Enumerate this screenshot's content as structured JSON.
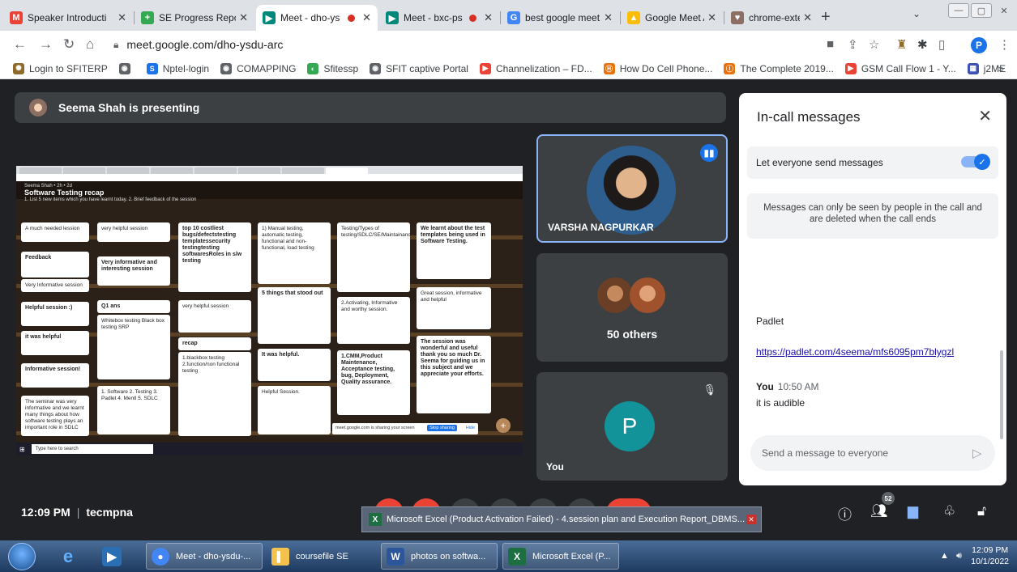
{
  "browser": {
    "tabs": [
      {
        "title": "Speaker Introducti",
        "fav_color": "#ea4335",
        "fav_glyph": "M"
      },
      {
        "title": "SE Progress Repor",
        "fav_color": "#34a853",
        "fav_glyph": "+"
      },
      {
        "title": "Meet - dho-ys",
        "fav_color": "#00897b",
        "fav_glyph": "▶",
        "recording": true,
        "active": true
      },
      {
        "title": "Meet - bxc-ps",
        "fav_color": "#00897b",
        "fav_glyph": "▶",
        "recording": true
      },
      {
        "title": "best google meet",
        "fav_color": "#4285f4",
        "fav_glyph": "G"
      },
      {
        "title": "Google Meet Atte",
        "fav_color": "#fbbc04",
        "fav_glyph": "▲"
      },
      {
        "title": "chrome-extension",
        "fav_color": "#8d6e63",
        "fav_glyph": "♥"
      }
    ],
    "url": "meet.google.com/dho-ysdu-arc",
    "profile_initial": "P",
    "bookmarks": [
      {
        "label": "Login to SFITERP",
        "color": "#8e6b2b"
      },
      {
        "label": "",
        "color": "#5f6368"
      },
      {
        "label": "Nptel-login",
        "color": "#1a73e8"
      },
      {
        "label": "COMAPPING",
        "color": "#5f6368"
      },
      {
        "label": "Sfitessp",
        "color": "#34a853"
      },
      {
        "label": "SFIT captive Portal",
        "color": "#5f6368"
      },
      {
        "label": "Channelization – FD...",
        "color": "#ea4335"
      },
      {
        "label": "How Do Cell Phone...",
        "color": "#e8710a"
      },
      {
        "label": "The Complete 2019...",
        "color": "#e8710a"
      },
      {
        "label": "GSM Call Flow 1 - Y...",
        "color": "#ea4335"
      },
      {
        "label": "j2ME",
        "color": "#3f51b5"
      }
    ]
  },
  "meet": {
    "presenter_banner": "Seema Shah is presenting",
    "shared_screen": {
      "board_author": "Seema Shah • 2h • 2d",
      "board_title": "Software Testing recap",
      "board_subtitle": "1. List 5 new items which you have learnt today. 2. Brief feedback of the session",
      "cards": [
        "A much needed lession",
        "Feedback",
        "Very Informative session",
        "Helpful session :)",
        "it was helpful",
        "Informative session!",
        "The seminar was very informative and we learnt many things about how software testing plays an important role in SDLC",
        "very helpful session",
        "Very informative and interesting session",
        "Q1 ans",
        "Whitebox testing Black box testing SRP",
        "1. Software 2. Testing 3. Padlet 4. Mentl 5. SDLC",
        "top 10 costliest bugs/defectstesting templatessecurity testingtesting softwaresRoles in s/w testing",
        "very helpful session",
        "recap",
        "1.blackbox testing 2.function/non functional testing",
        "1) Manual testing, automatic testing, functional and non-functional, load testing",
        "5 things that stood out",
        "It was helpful.",
        "Helpful Session.",
        "Testing/Types of testing/SDLC/SE/Maintainance",
        "2.Activating, Informative and worthy session.",
        "1.CMM,Product Maintenance, Acceptance testing, bug, Deployment, Quality assurance.",
        "We learnt about the test templates being used in Software Testing.",
        "Great session, informative and helpful",
        "The session was wonderful and useful thank you so much Dr. Seema for guiding us in this subject and we appreciate your efforts."
      ],
      "taskbar_search": "Type here to search",
      "sharing_banner": "meet.google.com is sharing your screen",
      "stop_sharing": "Stop sharing",
      "hide": "Hide"
    },
    "participants": {
      "speaker_name": "VARSHA NAGPURKAR",
      "others_label": "50 others",
      "self_name": "You",
      "self_initial": "P"
    },
    "chat": {
      "title": "In-call messages",
      "toggle_label": "Let everyone send messages",
      "toggle_on": true,
      "notice": "Messages can only be seen by people in the call and are deleted when the call ends",
      "messages": [
        {
          "text": "Padlet"
        },
        {
          "link": "https://padlet.com/4seema/mfs6095pm7blygzl"
        },
        {
          "sender": "You",
          "time": "10:50 AM",
          "text": "it is audible"
        }
      ],
      "input_placeholder": "Send a message to everyone"
    },
    "bottom": {
      "time": "12:09 PM",
      "meeting_code": "tecmpna",
      "people_count": "52"
    },
    "excel_popup": "Microsoft Excel (Product Activation Failed) - 4.session plan and Execution Report_DBMS..."
  },
  "taskbar": {
    "tasks": [
      {
        "label": "Meet - dho-ysdu-...",
        "icon_color": "#4285f4",
        "glyph": "●"
      },
      {
        "label": "coursefile SE",
        "icon_color": "#f2c14e",
        "glyph": "▌"
      },
      {
        "label": "photos on softwa...",
        "icon_color": "#2b579a",
        "glyph": "W"
      },
      {
        "label": "Microsoft Excel (P...",
        "icon_color": "#1d6f42",
        "glyph": "X"
      }
    ],
    "clock_time": "12:09 PM",
    "clock_date": "10/1/2022"
  }
}
